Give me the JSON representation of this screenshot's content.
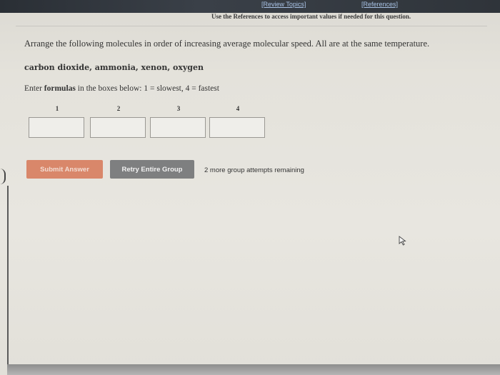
{
  "header": {
    "review_topics": "[Review Topics]",
    "references": "[References]",
    "note": "Use the References to access important values if needed for this question."
  },
  "question": {
    "prompt": "Arrange the following molecules in order of increasing average molecular speed. All are at the same temperature.",
    "molecules": "carbon dioxide, ammonia, xenon, oxygen",
    "instruction_prefix": "Enter ",
    "instruction_bold": "formulas",
    "instruction_suffix": " in the boxes below: 1 = slowest, 4 = fastest"
  },
  "answer_boxes": [
    {
      "label": "1",
      "value": ""
    },
    {
      "label": "2",
      "value": ""
    },
    {
      "label": "3",
      "value": ""
    },
    {
      "label": "4",
      "value": ""
    }
  ],
  "actions": {
    "submit_label": "Submit Answer",
    "retry_label": "Retry Entire Group",
    "attempts_text": "2 more group attempts remaining"
  },
  "colors": {
    "submit": "#d9876a",
    "retry": "#7e7f80",
    "link": "#a9c3e6"
  }
}
